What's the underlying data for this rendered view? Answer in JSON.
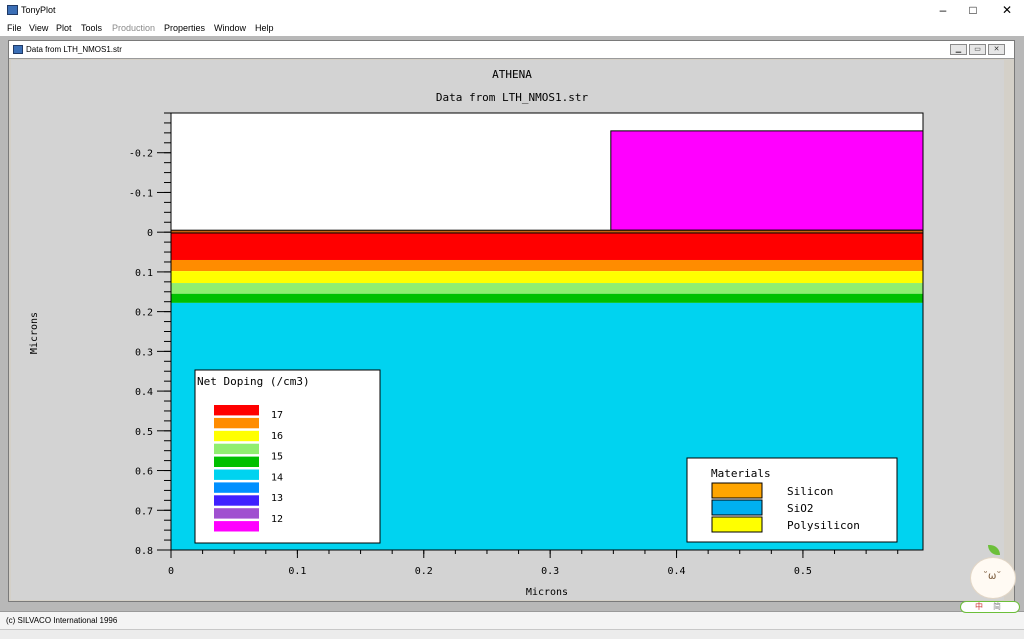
{
  "app": {
    "title": "TonyPlot",
    "minimize": "–",
    "maximize": "□",
    "close": "✕"
  },
  "menu": [
    "File",
    "View",
    "Plot",
    "Tools",
    "Production",
    "Properties",
    "Window",
    "Help"
  ],
  "menu_disabled": [
    "Production"
  ],
  "doc_window": {
    "title": "Data from LTH_NMOS1.str"
  },
  "plot": {
    "title": "ATHENA",
    "subtitle": "Data from LTH_NMOS1.str",
    "xlabel": "Microns",
    "ylabel": "Microns",
    "x_ticks": [
      "0",
      "0.1",
      "0.2",
      "0.3",
      "0.4",
      "0.5"
    ],
    "y_ticks": [
      "-0.2",
      "-0.1",
      "0",
      "0.1",
      "0.2",
      "0.3",
      "0.4",
      "0.5",
      "0.6",
      "0.7",
      "0.8"
    ],
    "colors": {
      "oxide_layer": "#d45a00",
      "poly": "#ff00ff",
      "substrate": "#00d3f0",
      "air": "#ffffff"
    }
  },
  "chart_data": {
    "type": "heatmap",
    "title": "ATHENA",
    "subtitle": "Data from LTH_NMOS1.str",
    "xlabel": "Microns",
    "ylabel": "Microns",
    "xlim": [
      0,
      0.595
    ],
    "ylim": [
      -0.3,
      0.8
    ],
    "y_inverted": true,
    "regions": [
      {
        "material": "Polysilicon",
        "x": [
          0.348,
          0.595
        ],
        "y": [
          -0.255,
          -0.005
        ],
        "fill": "#ff00ff"
      },
      {
        "material": "SiO2",
        "x": [
          0,
          0.595
        ],
        "y": [
          -0.005,
          0.002
        ],
        "fill": "#c56010"
      }
    ],
    "doping_bands": [
      {
        "y": [
          0.002,
          0.07
        ],
        "color": "#ff0000"
      },
      {
        "y": [
          0.07,
          0.098
        ],
        "color": "#ff8c00"
      },
      {
        "y": [
          0.098,
          0.128
        ],
        "color": "#ffff00"
      },
      {
        "y": [
          0.128,
          0.155
        ],
        "color": "#90ee70"
      },
      {
        "y": [
          0.155,
          0.178
        ],
        "color": "#00c000"
      },
      {
        "y": [
          0.178,
          0.8
        ],
        "color": "#00d3f0"
      }
    ],
    "legend_doping": {
      "title": "Net Doping (/cm3)",
      "colors": [
        "#ff0000",
        "#ff8c00",
        "#ffff00",
        "#90ee70",
        "#00c000",
        "#00d3f0",
        "#0090ff",
        "#4020ff",
        "#a050d0",
        "#ff00ff"
      ],
      "labels": [
        "17",
        "16",
        "15",
        "14",
        "13",
        "12"
      ],
      "placement": "bottom-left"
    },
    "legend_materials": {
      "title": "Materials",
      "items": [
        {
          "name": "Silicon",
          "color": "#ffa500"
        },
        {
          "name": "SiO2",
          "color": "#00b0f0"
        },
        {
          "name": "Polysilicon",
          "color": "#ffff00"
        }
      ],
      "placement": "bottom-right"
    }
  },
  "status": {
    "text": "(c) SILVACO International 1996"
  },
  "ime": {
    "face": "˘ω˘",
    "chars": [
      "中",
      "简"
    ]
  }
}
